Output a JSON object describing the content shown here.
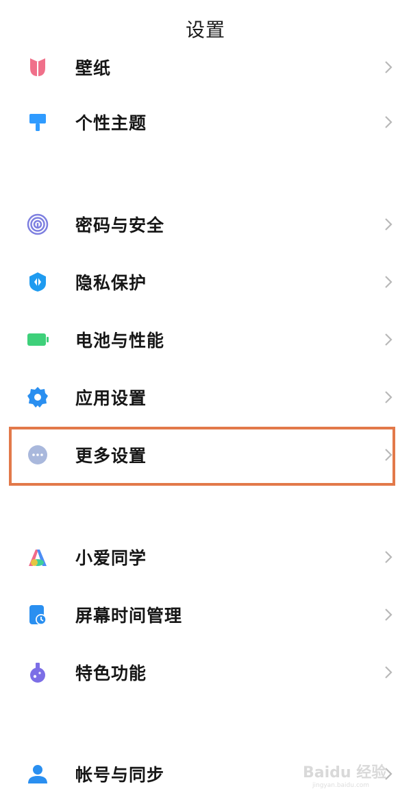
{
  "header": {
    "title": "设置"
  },
  "items": [
    {
      "key": "wallpaper",
      "label": "壁纸",
      "icon": "wallpaper-icon"
    },
    {
      "key": "theme",
      "label": "个性主题",
      "icon": "theme-brush-icon"
    },
    {
      "key": "security",
      "label": "密码与安全",
      "icon": "fingerprint-icon"
    },
    {
      "key": "privacy",
      "label": "隐私保护",
      "icon": "privacy-shield-icon"
    },
    {
      "key": "battery",
      "label": "电池与性能",
      "icon": "battery-icon"
    },
    {
      "key": "apps",
      "label": "应用设置",
      "icon": "gear-icon"
    },
    {
      "key": "more",
      "label": "更多设置",
      "icon": "more-dots-icon",
      "highlighted": true
    },
    {
      "key": "xiaoai",
      "label": "小爱同学",
      "icon": "xiaoai-assistant-icon"
    },
    {
      "key": "screentime",
      "label": "屏幕时间管理",
      "icon": "screen-time-icon"
    },
    {
      "key": "features",
      "label": "特色功能",
      "icon": "special-features-icon"
    },
    {
      "key": "account",
      "label": "帐号与同步",
      "icon": "account-icon"
    }
  ],
  "colors": {
    "highlight_border": "#e2794a",
    "chevron": "#b8b8b8"
  },
  "watermark": {
    "text": "Baidu 经验",
    "subtext": "jingyan.baidu.com"
  }
}
